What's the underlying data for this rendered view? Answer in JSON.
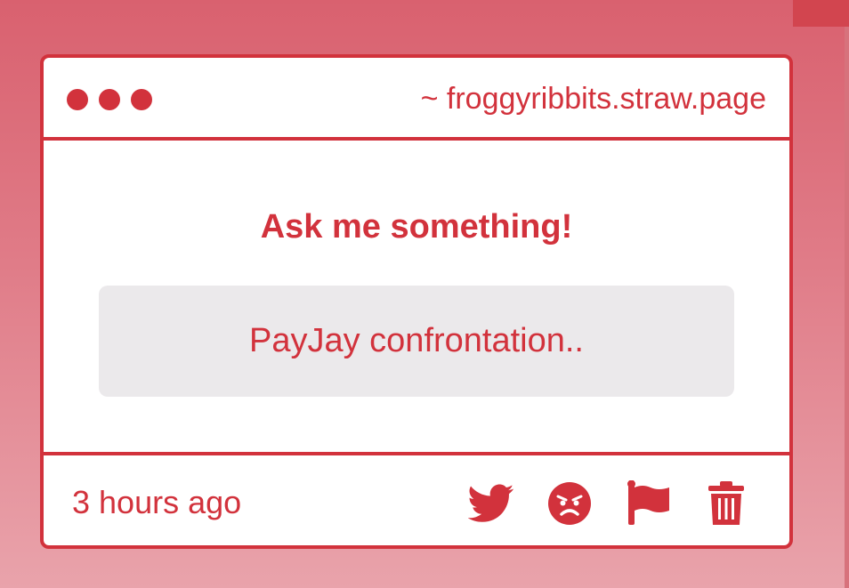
{
  "window": {
    "url": "~ froggyribbits.straw.page"
  },
  "main": {
    "heading": "Ask me something!",
    "question": "PayJay confrontation.."
  },
  "footer": {
    "timestamp": "3 hours ago",
    "actions": [
      {
        "icon": "twitter-icon"
      },
      {
        "icon": "angry-face-icon"
      },
      {
        "icon": "flag-icon"
      },
      {
        "icon": "trash-icon"
      }
    ]
  },
  "colors": {
    "accent": "#d2323c",
    "question_bg": "#ebe9eb",
    "background_top": "#d9616f",
    "background_bottom": "#e9a3ab"
  }
}
